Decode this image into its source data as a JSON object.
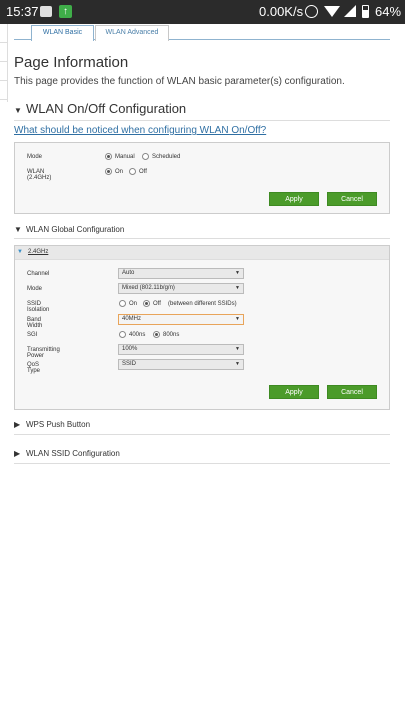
{
  "status_bar": {
    "time": "15:37",
    "network_speed": "0.00K/s",
    "battery": "64%",
    "notif_icons": [
      "message-icon",
      "download-icon"
    ]
  },
  "tabs": [
    {
      "label": "WLAN Basic",
      "active": true
    },
    {
      "label": "WLAN Advanced",
      "active": false
    }
  ],
  "page": {
    "title": "Page Information",
    "description": "This page provides the function of WLAN basic parameter(s) configuration."
  },
  "onoff": {
    "heading": "WLAN On/Off Configuration",
    "help_link": "What should be noticed when configuring WLAN On/Off?",
    "mode_label": "Mode",
    "mode_options": [
      "Manual",
      "Scheduled"
    ],
    "mode_selected": "Manual",
    "wlan_label": "WLAN (2.4GHz)",
    "wlan_options": [
      "On",
      "Off"
    ],
    "wlan_selected": "On",
    "apply": "Apply",
    "cancel": "Cancel"
  },
  "global": {
    "heading": "WLAN Global Configuration",
    "band_tab": "2.4GHz",
    "channel_label": "Channel",
    "channel_value": "Auto",
    "mode_label": "Mode",
    "mode_value": "Mixed (802.11b/g/n)",
    "isolation_label": "SSID Isolation",
    "isolation_options": [
      "On",
      "Off"
    ],
    "isolation_selected": "Off",
    "isolation_note": "(between different SSIDs)",
    "bandwidth_label": "Band Width",
    "bandwidth_value": "40MHz",
    "sgi_label": "SGI",
    "sgi_options": [
      "400ns",
      "800ns"
    ],
    "sgi_selected": "800ns",
    "power_label": "Transmitting Power",
    "power_value": "100%",
    "qos_label": "QoS Type",
    "qos_value": "SSID",
    "apply": "Apply",
    "cancel": "Cancel"
  },
  "collapsed_sections": {
    "wps": "WPS Push Button",
    "ssid": "WLAN SSID Configuration"
  },
  "colors": {
    "accent_green": "#4b9b2a",
    "link_blue": "#2f6fa3",
    "focus_orange": "#e8a45a"
  }
}
